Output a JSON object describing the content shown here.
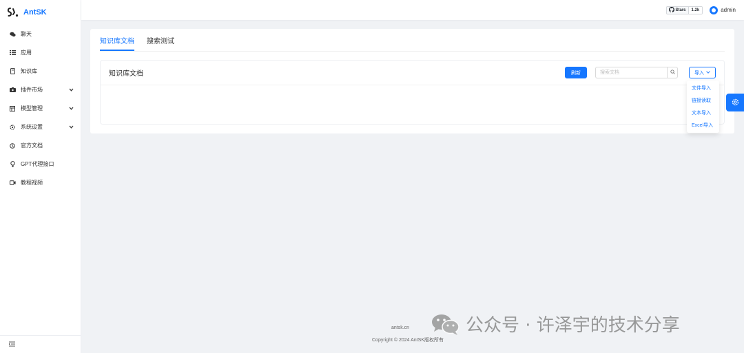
{
  "app": {
    "brand": "AntSK"
  },
  "sidebar": {
    "items": [
      {
        "label": "聊天",
        "icon": "chat-icon"
      },
      {
        "label": "应用",
        "icon": "apps-icon"
      },
      {
        "label": "知识库",
        "icon": "book-icon"
      },
      {
        "label": "插件市场",
        "icon": "plugin-icon",
        "expandable": true
      },
      {
        "label": "模型管理",
        "icon": "model-icon",
        "expandable": true
      },
      {
        "label": "系统设置",
        "icon": "gear-icon",
        "expandable": true
      },
      {
        "label": "官方文档",
        "icon": "docs-icon"
      },
      {
        "label": "GPT代理接口",
        "icon": "bulb-icon"
      },
      {
        "label": "教程视频",
        "icon": "video-icon"
      }
    ]
  },
  "header": {
    "github_label": "Stars",
    "github_count": "1.2k",
    "user_name": "admin"
  },
  "tabs": [
    {
      "label": "知识库文档",
      "active": true
    },
    {
      "label": "搜索测试",
      "active": false
    }
  ],
  "panel": {
    "title": "知识库文档",
    "refresh_label": "刷新",
    "search_placeholder": "搜索文档",
    "import_label": "导入"
  },
  "import_menu": [
    "文件导入",
    "链接读取",
    "文本导入",
    "Excel导入"
  ],
  "footer": {
    "link": "antsk.cn",
    "copyright": "Copyright © 2024 AntSK版权所有"
  },
  "watermark": "公众号 · 许泽宇的技术分享",
  "colors": {
    "primary": "#1677ff",
    "background": "#f0f2f5"
  }
}
